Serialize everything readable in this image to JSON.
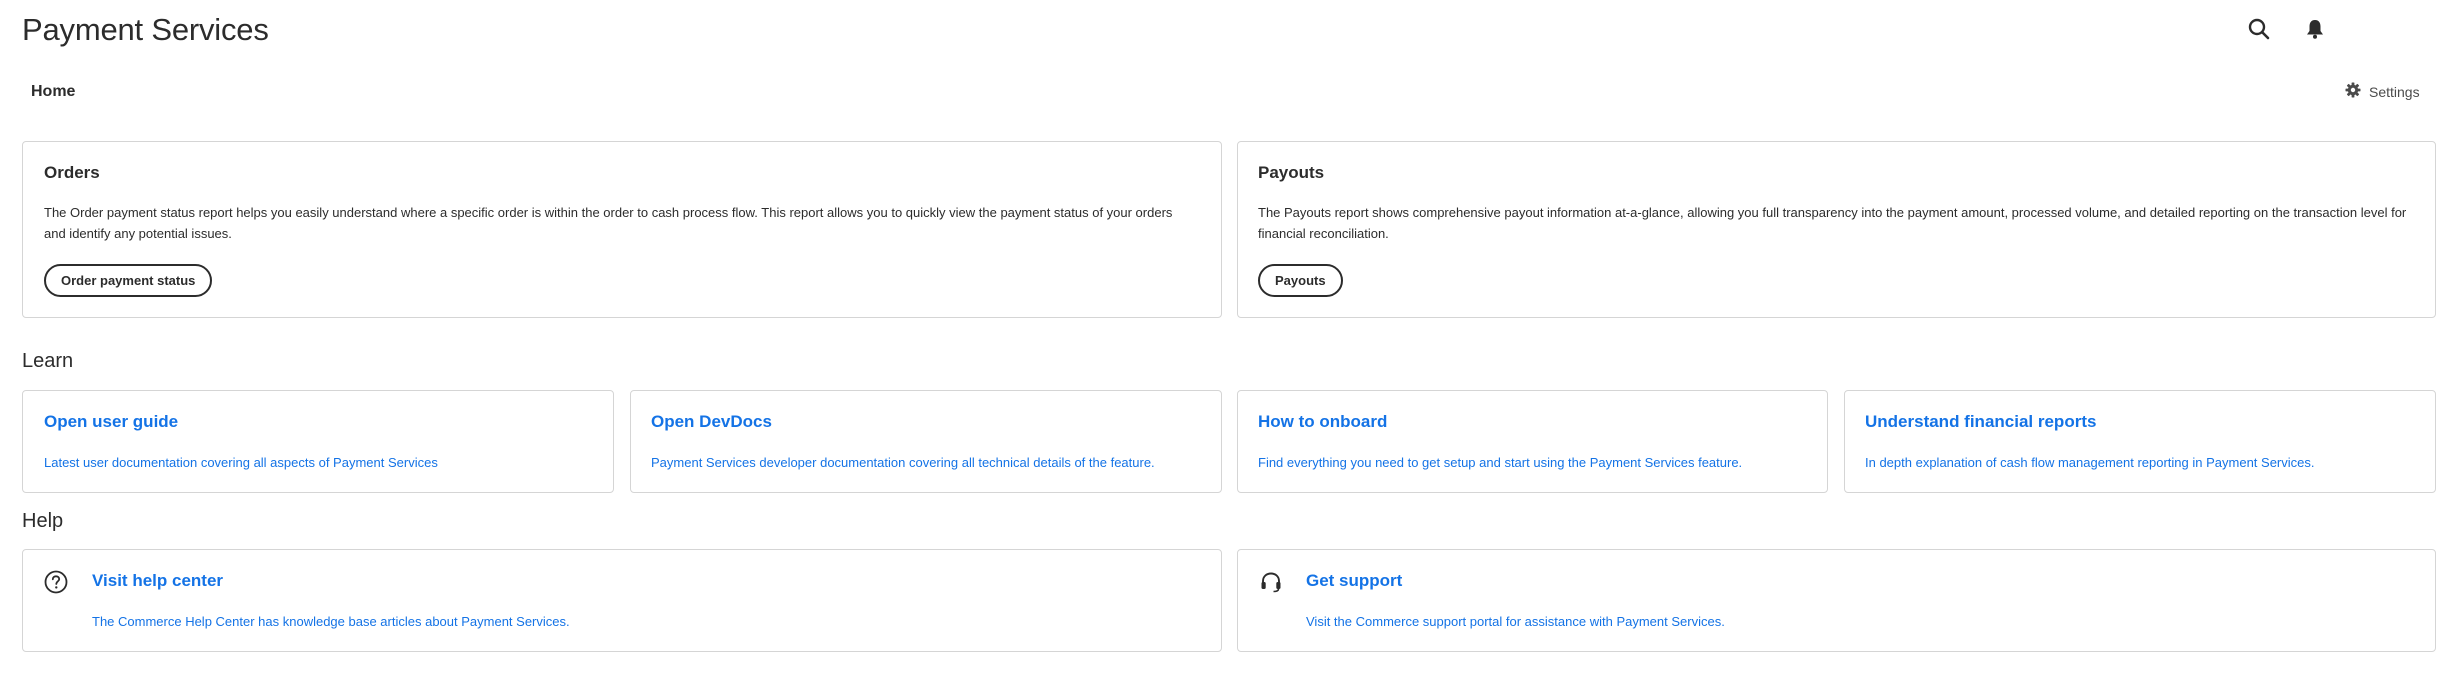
{
  "header": {
    "title": "Payment Services",
    "icons": [
      "search-icon",
      "bell-icon"
    ]
  },
  "breadcrumb": {
    "label": "Home"
  },
  "settings": {
    "label": "Settings",
    "icon": "gear-icon"
  },
  "reports": [
    {
      "title": "Orders",
      "description": "The Order payment status report helps you easily understand where a specific order is within the order to cash process flow. This report allows you to quickly view the payment status of your orders and identify any potential issues.",
      "button_label": "Order payment status"
    },
    {
      "title": "Payouts",
      "description": "The Payouts report shows comprehensive payout information at-a-glance, allowing you full transparency into the payment amount, processed volume, and detailed reporting on the transaction level for financial reconciliation.",
      "button_label": "Payouts"
    }
  ],
  "learn": {
    "heading": "Learn",
    "items": [
      {
        "title": "Open user guide",
        "description": "Latest user documentation covering all aspects of Payment Services"
      },
      {
        "title": "Open DevDocs",
        "description": "Payment Services developer documentation covering all technical details of the feature."
      },
      {
        "title": "How to onboard",
        "description": "Find everything you need to get setup and start using the Payment Services feature."
      },
      {
        "title": "Understand financial reports",
        "description": "In depth explanation of cash flow management reporting in Payment Services."
      }
    ]
  },
  "help": {
    "heading": "Help",
    "items": [
      {
        "title": "Visit help center",
        "description": "The Commerce Help Center has knowledge base articles about Payment Services.",
        "icon": "help-circle-icon"
      },
      {
        "title": "Get support",
        "description": "Visit the Commerce support portal for assistance with Payment Services.",
        "icon": "headset-icon"
      }
    ]
  },
  "colors": {
    "link": "#1473e6",
    "text": "#2c2c2c",
    "border": "#d5d5d5"
  }
}
